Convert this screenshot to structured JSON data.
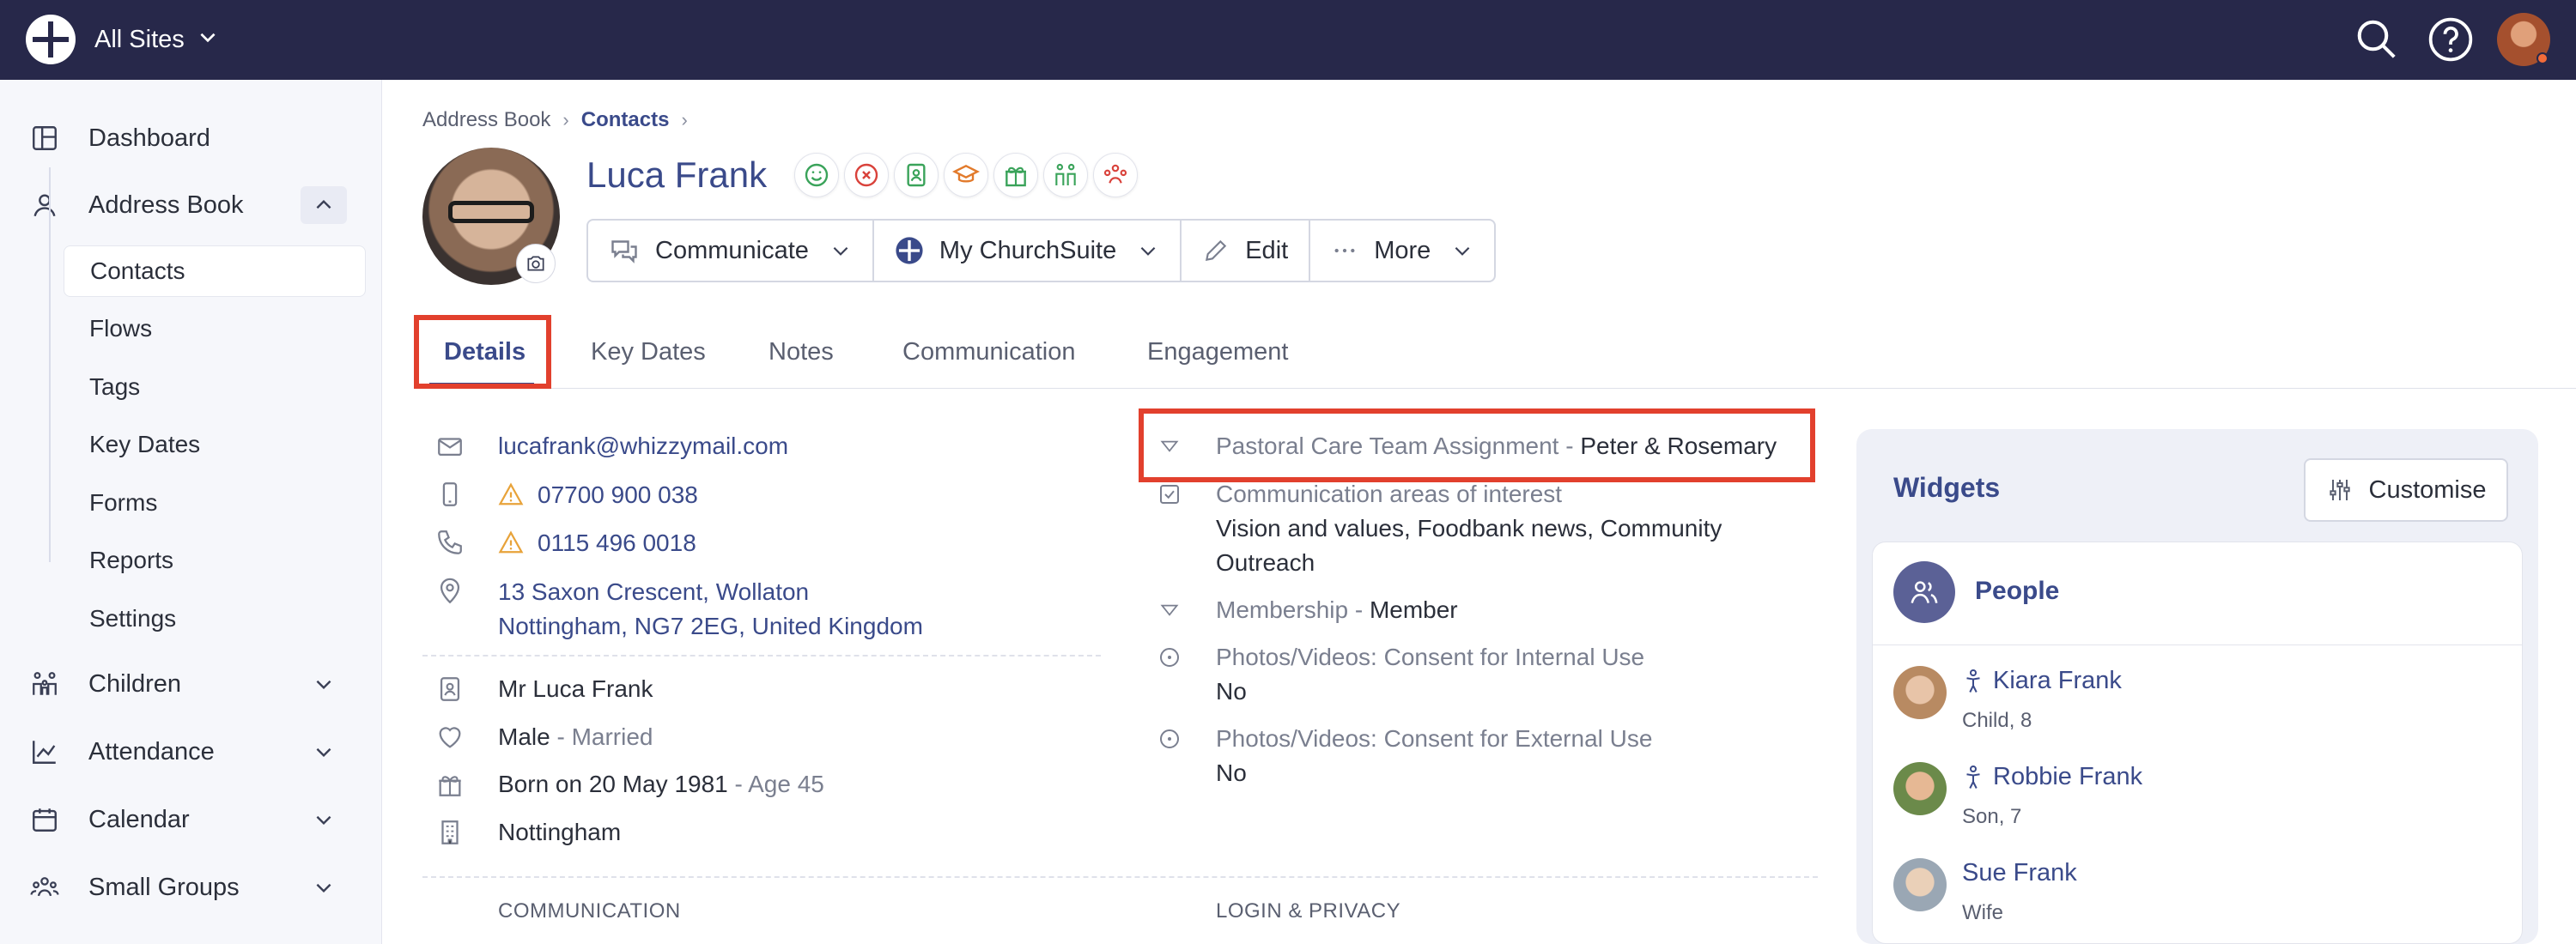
{
  "topbar": {
    "site": "All Sites"
  },
  "sidebar": {
    "items": [
      {
        "label": "Dashboard"
      },
      {
        "label": "Address Book"
      },
      {
        "label": "Children"
      },
      {
        "label": "Attendance"
      },
      {
        "label": "Calendar"
      },
      {
        "label": "Small Groups"
      }
    ],
    "address_book_sub": [
      "Contacts",
      "Flows",
      "Tags",
      "Key Dates",
      "Forms",
      "Reports",
      "Settings"
    ]
  },
  "breadcrumb": {
    "root": "Address Book",
    "current": "Contacts"
  },
  "person": {
    "name": "Luca Frank"
  },
  "badges": {
    "colors": [
      "#3aa35a",
      "#d9423b",
      "#3aa35a",
      "#e27a2b",
      "#3aa35a",
      "#3aa35a",
      "#d9423b"
    ]
  },
  "actions": {
    "communicate": "Communicate",
    "mychurchsuite": "My ChurchSuite",
    "edit": "Edit",
    "more": "More"
  },
  "tabs": [
    "Details",
    "Key Dates",
    "Notes",
    "Communication",
    "Engagement"
  ],
  "details": {
    "email": "lucafrank@whizzymail.com",
    "mobile": "07700 900 038",
    "phone": "0115 496 0018",
    "address_line1": "13 Saxon Crescent, Wollaton",
    "address_line2": "Nottingham, NG7 2EG, United Kingdom",
    "full_name": "Mr Luca Frank",
    "sex": "Male",
    "marital": " - Married",
    "born": "Born on 20 May 1981",
    "age": " - Age 45",
    "site": "Nottingham"
  },
  "fields": {
    "pastoral_label": "Pastoral Care Team Assignment - ",
    "pastoral_value": "Peter & Rosemary",
    "comm_label": "Communication areas of interest",
    "comm_value_line1": "Vision and values, Foodbank news, Community",
    "comm_value_line2": "Outreach",
    "membership_label": "Membership - ",
    "membership_value": "Member",
    "photos_internal_label": "Photos/Videos: Consent for Internal Use",
    "photos_internal_value": "No",
    "photos_external_label": "Photos/Videos: Consent for External Use",
    "photos_external_value": "No"
  },
  "sections": {
    "communication": "COMMUNICATION",
    "login_privacy": "LOGIN & PRIVACY"
  },
  "widgets": {
    "title": "Widgets",
    "customise": "Customise",
    "people_title": "People",
    "people": [
      {
        "name": "Kiara Frank",
        "relation": "Child, 8"
      },
      {
        "name": "Robbie Frank",
        "relation": "Son, 7"
      },
      {
        "name": "Sue Frank",
        "relation": "Wife"
      }
    ]
  }
}
